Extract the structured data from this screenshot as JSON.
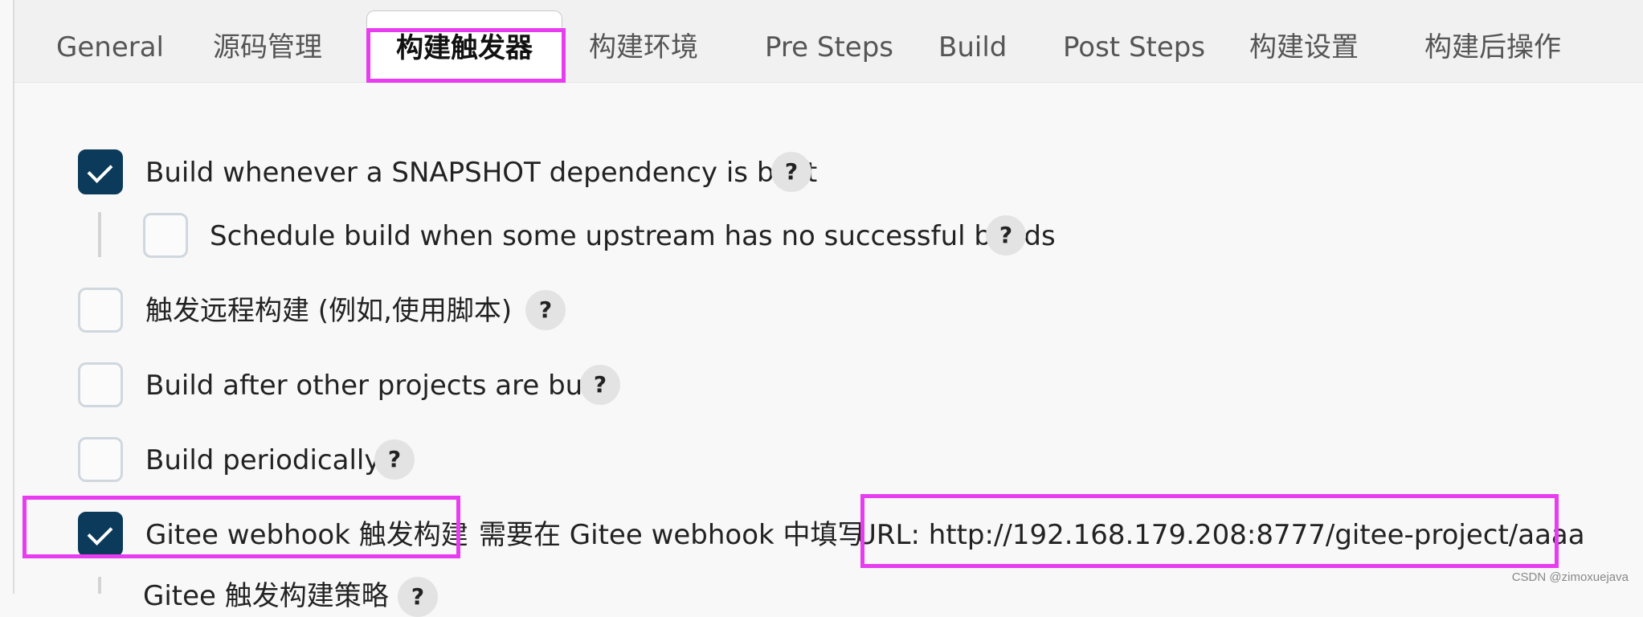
{
  "tabs": [
    {
      "label": "General"
    },
    {
      "label": "源码管理"
    },
    {
      "label": "构建触发器",
      "active": true
    },
    {
      "label": "构建环境"
    },
    {
      "label": "Pre Steps"
    },
    {
      "label": "Build"
    },
    {
      "label": "Post Steps"
    },
    {
      "label": "构建设置"
    },
    {
      "label": "构建后操作"
    }
  ],
  "triggers": {
    "snapshot": {
      "label": "Build whenever a SNAPSHOT dependency is built",
      "checked": true
    },
    "schedule_upstream": {
      "label": "Schedule build when some upstream has no successful builds",
      "checked": false
    },
    "remote": {
      "label": "触发远程构建 (例如,使用脚本)",
      "checked": false
    },
    "after_other": {
      "label": "Build after other projects are built",
      "checked": false
    },
    "periodically": {
      "label": "Build periodically",
      "checked": false
    },
    "gitee": {
      "label": "Gitee webhook 触发构建",
      "checked": true
    },
    "gitee_policy": {
      "label": "Gitee 触发构建策略"
    }
  },
  "gitee_hint": {
    "prefix": "需要在 Gitee webhook 中填写",
    "url": "URL: http://192.168.179.208:8777/gitee-project/aaaa"
  },
  "help_glyph": "?",
  "watermark": "CSDN @zimoxuejava",
  "colors": {
    "checked": "#0b3a5b",
    "highlight": "#e83cf0"
  }
}
